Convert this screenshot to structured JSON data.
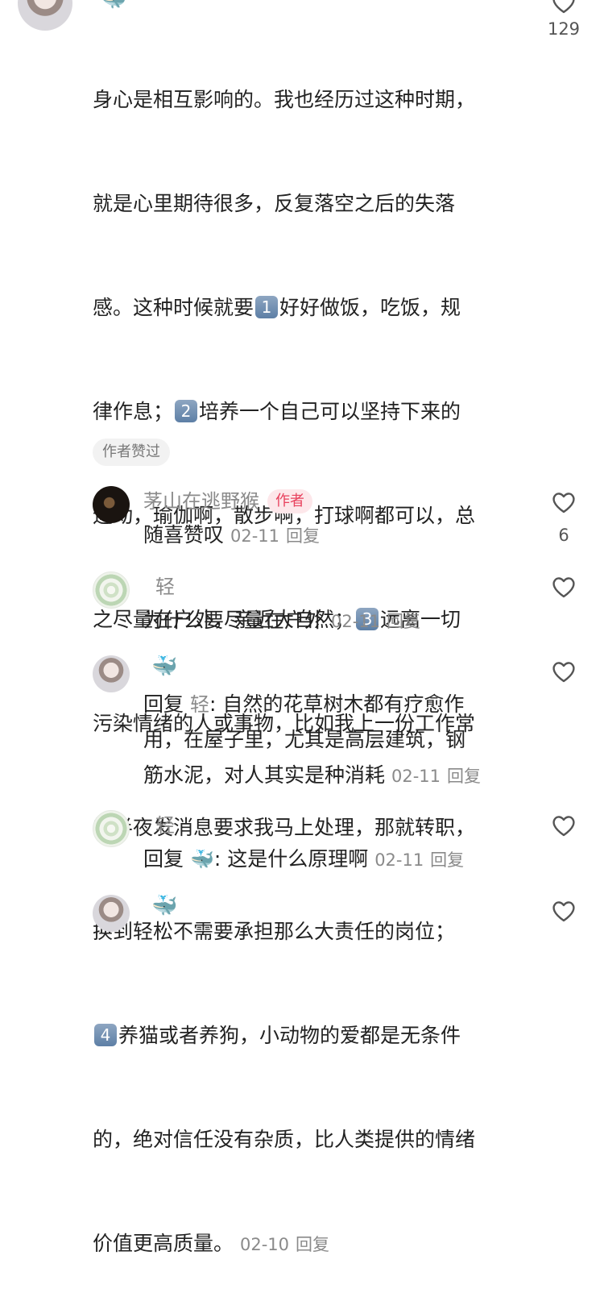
{
  "top_comment": {
    "avatar": "person-avatar",
    "text_line1": "身心是相互影响的。我也经历过这种时期，",
    "text_line2": "就是心里期待很多，反复落空之后的失落",
    "text_line3a": "感。这种时候就要",
    "num1": "1",
    "text_line3b": "好好做饭，吃饭，规",
    "text_line4a": "律作息；",
    "num2": "2",
    "text_line4b": "培养一个自己可以坚持下来的",
    "text_line5": "运动，瑜伽啊，散步啊，打球啊都可以，总",
    "text_line6a": "之尽量在户外，亲近大自然；",
    "num3": "3",
    "text_line6b": "远离一切",
    "text_line7": "污染情绪的人或事物，比如我上一份工作常",
    "text_line8": "常半夜发消息要求我马上处理，那就转职，",
    "text_line9": "换到轻松不需要承担那么大责任的岗位；",
    "num4": "4",
    "text_line10b": "养猫或者养狗，小动物的爱都是无条件",
    "text_line11": "的，绝对信任没有杂质，比人类提供的情绪",
    "text_line12": "价值更高质量。",
    "date": "02-10",
    "reply_label": "回复",
    "like_count": "129",
    "author_liked_tag": "作者赞过"
  },
  "replies": [
    {
      "avatar": "dark-avatar",
      "username": "茅山在逃野猴",
      "author_tag": "作者",
      "text": "随喜赞叹",
      "date": "02-11",
      "reply_label": "回复",
      "like_count": "6"
    },
    {
      "avatar": "flower-avatar",
      "username": "轻",
      "text": "为什么要尽量在户外",
      "date": "02-11",
      "reply_label": "回复"
    },
    {
      "avatar": "person-avatar",
      "username_icon": "🐳",
      "reply_prefix": "回复",
      "reply_target": "轻",
      "line1": ": 自然的花草树木都有疗愈作",
      "line2": "用，在屋子里，尤其是高层建筑，钢",
      "line3": "筋水泥，对人其实是种消耗",
      "date": "02-11",
      "reply_label": "回复"
    },
    {
      "avatar": "flower-avatar",
      "username": "轻",
      "reply_prefix": "回复",
      "reply_target_icon": "🐳",
      "text": ": 这是什么原理啊",
      "date": "02-11",
      "reply_label": "回复"
    },
    {
      "avatar": "person-avatar",
      "username_icon": "🐳"
    }
  ],
  "colors": {
    "accent_author": "#e8415d",
    "meta_gray": "#8a8a8a",
    "text": "#222222"
  }
}
